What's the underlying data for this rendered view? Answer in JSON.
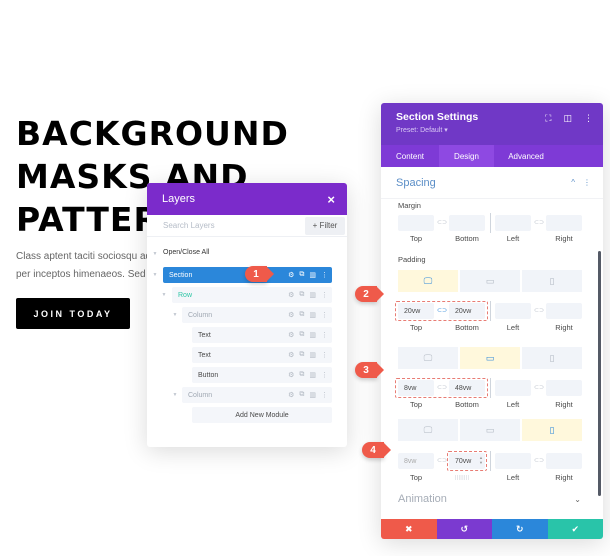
{
  "hero": {
    "title_lines": [
      "BACKGROUND",
      "MASKS AND",
      "PATTERNS"
    ],
    "body_lines": [
      "Class aptent taciti sociosqu ad litora",
      "per inceptos himenaeos. Sed mi"
    ],
    "button_label": "JOIN TODAY"
  },
  "layers": {
    "title": "Layers",
    "close_icon": "×",
    "search_placeholder": "Search Layers",
    "filter_label": "+ Filter",
    "open_close_all": "Open/Close All",
    "tree": [
      {
        "label": "Section",
        "type": "section",
        "level": 0
      },
      {
        "label": "Row",
        "type": "row",
        "level": 1
      },
      {
        "label": "Column",
        "type": "column",
        "level": 2
      },
      {
        "label": "Text",
        "type": "module",
        "level": 3
      },
      {
        "label": "Text",
        "type": "module",
        "level": 3
      },
      {
        "label": "Button",
        "type": "module",
        "level": 3
      },
      {
        "label": "Column",
        "type": "column",
        "level": 2
      }
    ],
    "add_module_label": "Add New Module",
    "row_icons": {
      "settings": "⚙",
      "duplicate": "⧉",
      "delete": "🗑",
      "more": "⋮"
    }
  },
  "badges": [
    "1",
    "2",
    "3",
    "4"
  ],
  "settings": {
    "title": "Section Settings",
    "preset": "Preset: Default ▾",
    "header_icons": {
      "expand": "⛶",
      "split": "◫",
      "more": "⋮"
    },
    "tabs": [
      {
        "label": "Content",
        "active": false
      },
      {
        "label": "Design",
        "active": true
      },
      {
        "label": "Advanced",
        "active": false
      }
    ],
    "spacing_title": "Spacing",
    "spacing_collapse": "^",
    "spacing_more": "⋮",
    "margin_label": "Margin",
    "padding_label": "Padding",
    "sub_labels": {
      "top": "Top",
      "bottom": "Bottom",
      "left": "Left",
      "right": "Right"
    },
    "link_icon": "⊂⊃",
    "margin": {
      "top": "",
      "bottom": "",
      "left": "",
      "right": ""
    },
    "padding_desktop": {
      "device": "desktop",
      "top": "20vw",
      "bottom": "20vw",
      "left": "",
      "right": "",
      "linked": true
    },
    "padding_tablet": {
      "device": "tablet",
      "top": "8vw",
      "bottom": "48vw",
      "left": "",
      "right": ""
    },
    "padding_phone": {
      "device": "phone",
      "top": "8vw",
      "bottom": "70vw",
      "left": "",
      "right": ""
    },
    "device_icons": {
      "desktop": "🖵",
      "tablet": "▭",
      "phone": "▯"
    },
    "animation_title": "Animation",
    "animation_chevron": "⌄",
    "footer": {
      "cancel": "✖",
      "undo": "↺",
      "redo": "↻",
      "save": "✔"
    },
    "colors": {
      "cancel": "#ef5a4a",
      "undo": "#7b3ad0",
      "redo": "#2b87da",
      "save": "#29c4a9"
    }
  }
}
